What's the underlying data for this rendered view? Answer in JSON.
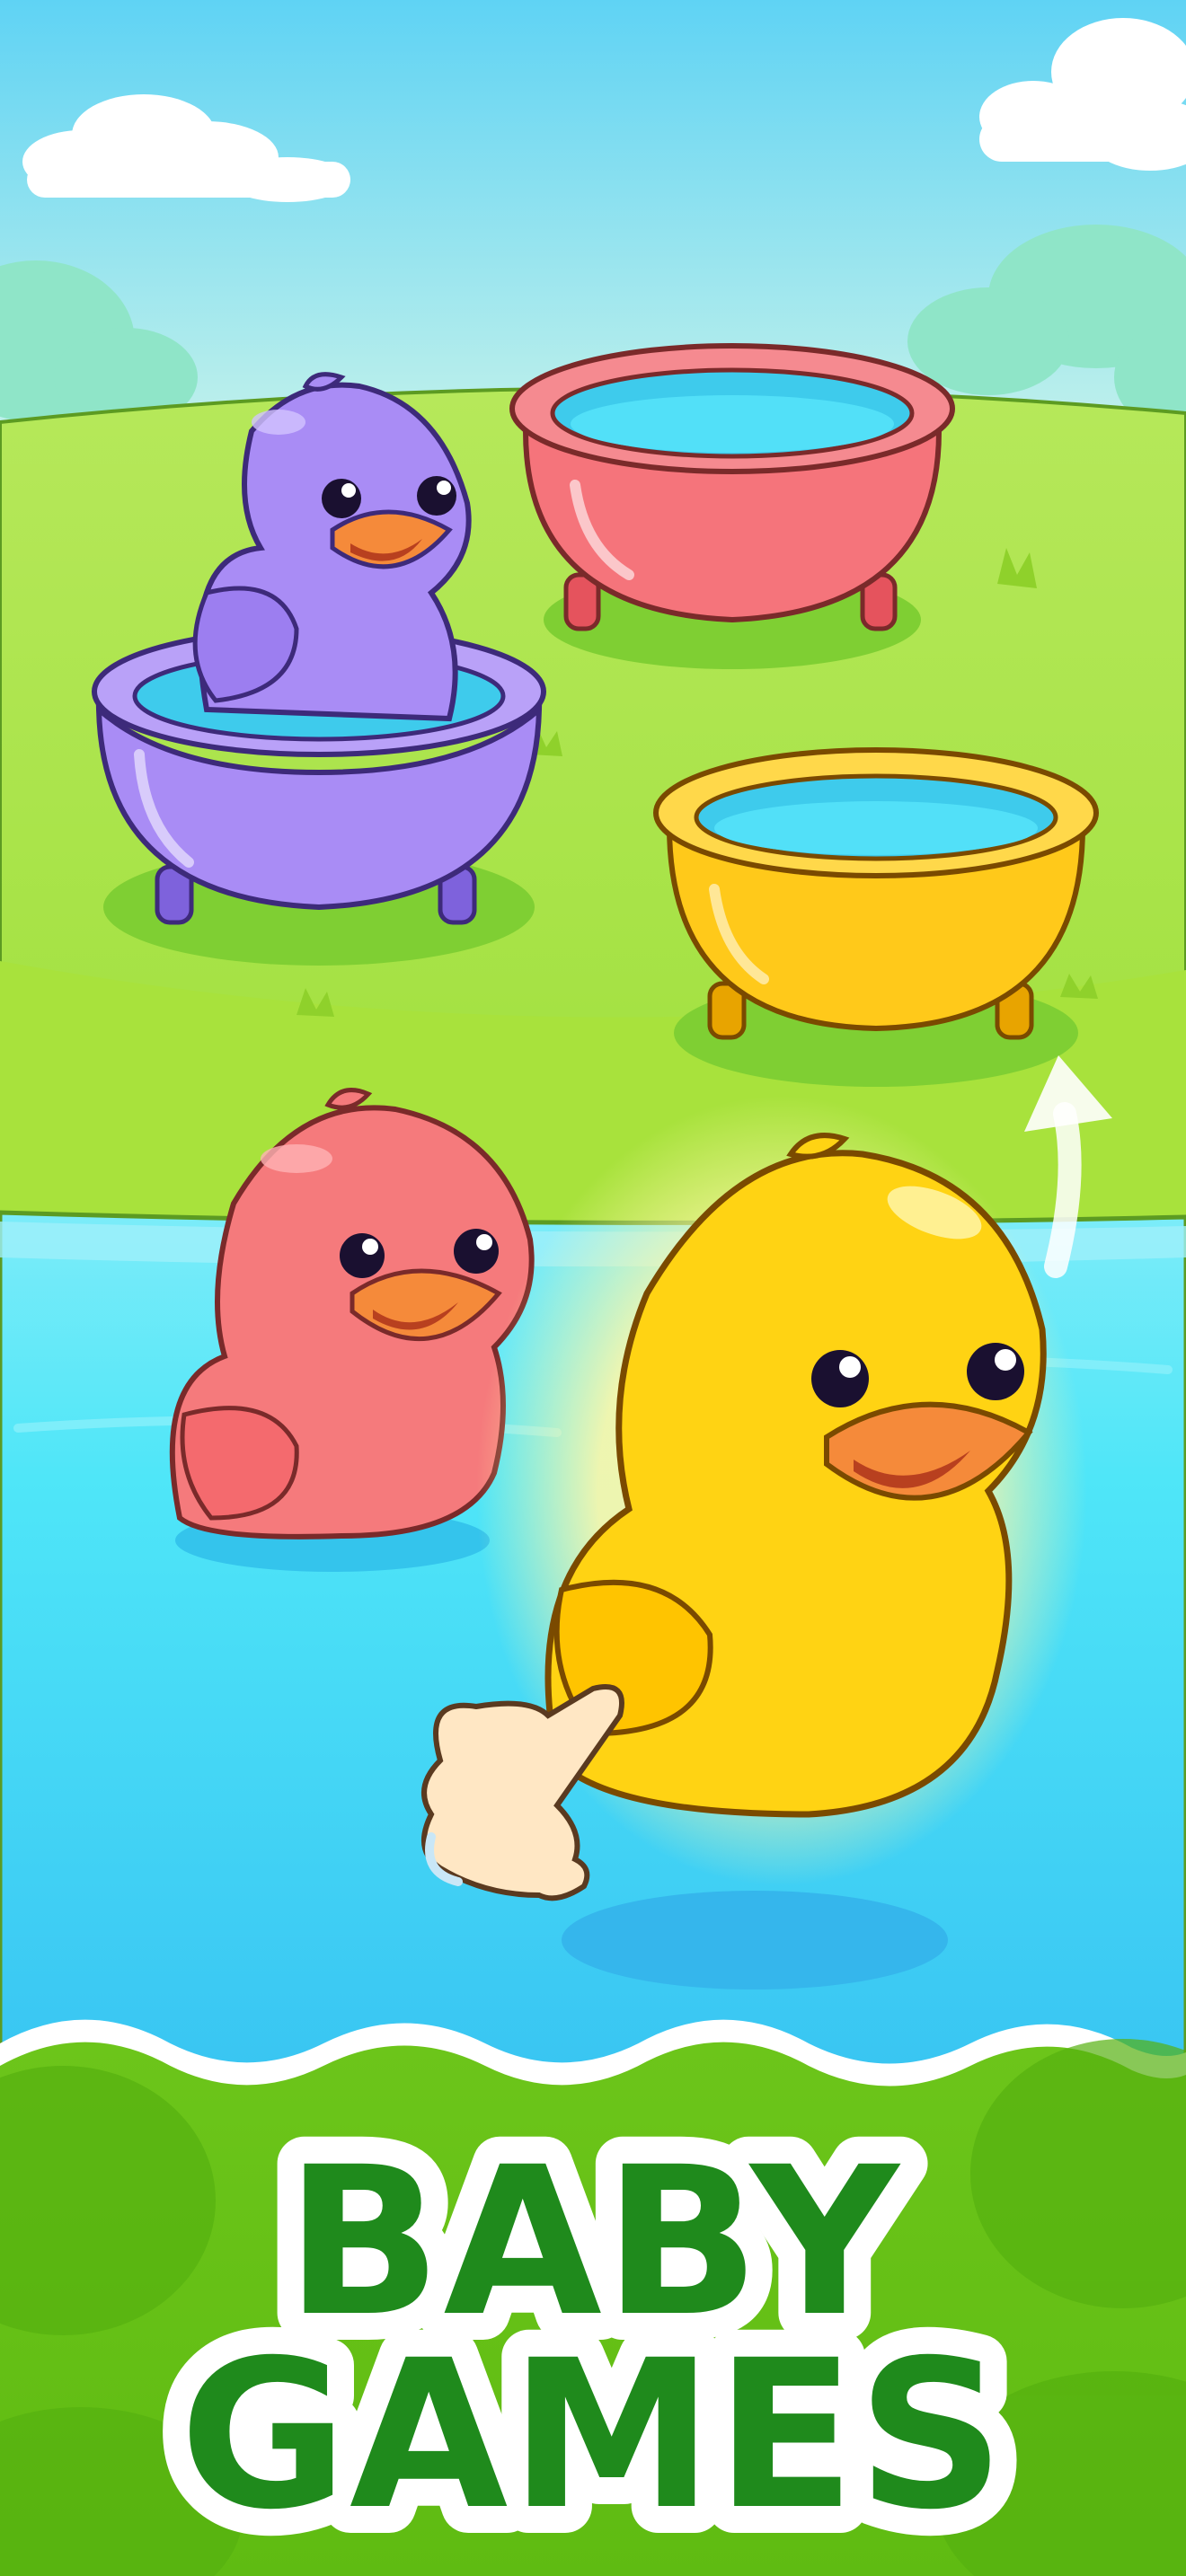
{
  "title": {
    "line1": "BABY",
    "line2": "GAMES"
  },
  "colors": {
    "sky_top": "#6fd8f5",
    "sky_bottom": "#c9f2e9",
    "grass": "#9ade3a",
    "water": "#4be3f6",
    "title_fill": "#1f8a1c",
    "title_outline": "#ffffff",
    "duck_purple": "#a98cf5",
    "duck_pink": "#f57a7c",
    "duck_yellow": "#ffd313",
    "tub_pink": "#f5747b",
    "tub_purple": "#a98cf5",
    "tub_yellow": "#ffc91a"
  },
  "scene": {
    "ducks": [
      {
        "name": "purple-duck",
        "color": "purple",
        "location": "in purple tub"
      },
      {
        "name": "pink-duck",
        "color": "pink",
        "location": "in water"
      },
      {
        "name": "yellow-duck",
        "color": "yellow",
        "location": "in water",
        "highlighted": true
      }
    ],
    "tubs": [
      {
        "name": "pink-tub",
        "color": "pink",
        "occupied": false
      },
      {
        "name": "purple-tub",
        "color": "purple",
        "occupied": true
      },
      {
        "name": "yellow-tub",
        "color": "yellow",
        "occupied": false
      }
    ],
    "hint": {
      "icon": "pointing-hand-icon",
      "arrow": "curved-arrow-icon"
    }
  }
}
